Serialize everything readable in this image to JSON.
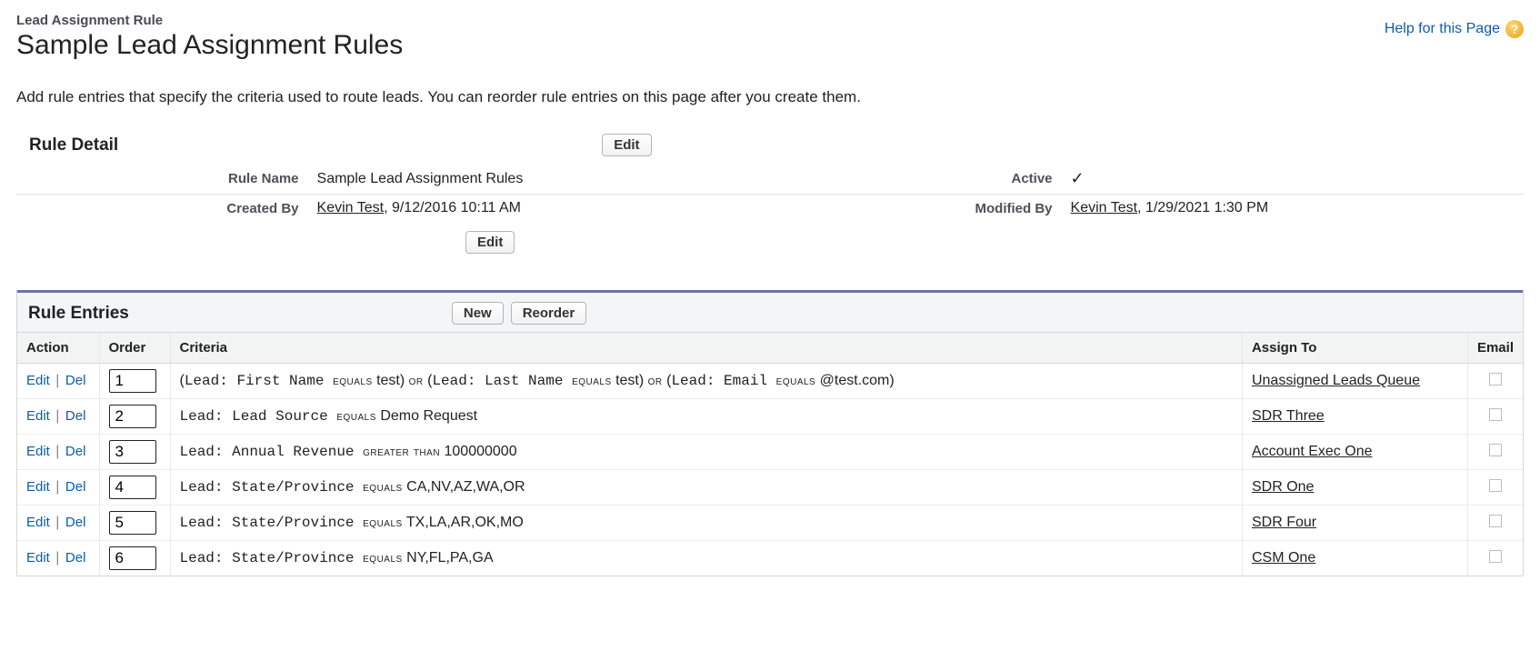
{
  "header": {
    "eyebrow": "Lead Assignment Rule",
    "title": "Sample Lead Assignment Rules",
    "help_label": "Help for this Page",
    "help_icon_char": "?"
  },
  "intro": "Add rule entries that specify the criteria used to route leads. You can reorder rule entries on this page after you create them.",
  "rule_detail": {
    "section_label": "Rule Detail",
    "edit_label": "Edit",
    "fields": {
      "rule_name_label": "Rule Name",
      "rule_name_value": "Sample Lead Assignment Rules",
      "active_label": "Active",
      "active_check": "✓",
      "created_by_label": "Created By",
      "created_by_user": "Kevin Test",
      "created_by_ts": ", 9/12/2016 10:11 AM",
      "modified_by_label": "Modified By",
      "modified_by_user": "Kevin Test",
      "modified_by_ts": ", 1/29/2021 1:30 PM"
    }
  },
  "rule_entries": {
    "section_label": "Rule Entries",
    "new_label": "New",
    "reorder_label": "Reorder",
    "columns": {
      "action": "Action",
      "order": "Order",
      "criteria": "Criteria",
      "assign_to": "Assign To",
      "email": "Email"
    },
    "action_edit": "Edit",
    "action_del": "Del",
    "action_sep": "|",
    "rows": [
      {
        "order": "1",
        "criteria_segments": [
          {
            "t": "(",
            "cls": ""
          },
          {
            "t": "Lead: First Name ",
            "cls": "mono"
          },
          {
            "t": "equals",
            "cls": "smallcaps"
          },
          {
            "t": " test",
            "cls": ""
          },
          {
            "t": ") ",
            "cls": ""
          },
          {
            "t": "or",
            "cls": "smallcaps"
          },
          {
            "t": " (",
            "cls": ""
          },
          {
            "t": "Lead: Last Name ",
            "cls": "mono"
          },
          {
            "t": "equals",
            "cls": "smallcaps"
          },
          {
            "t": " test",
            "cls": ""
          },
          {
            "t": ") ",
            "cls": ""
          },
          {
            "t": "or",
            "cls": "smallcaps"
          },
          {
            "t": " (",
            "cls": ""
          },
          {
            "t": "Lead: Email ",
            "cls": "mono"
          },
          {
            "t": "equals",
            "cls": "smallcaps"
          },
          {
            "t": " @test.com",
            "cls": ""
          },
          {
            "t": ")",
            "cls": ""
          }
        ],
        "assign_to": "Unassigned Leads Queue",
        "email": false
      },
      {
        "order": "2",
        "criteria_segments": [
          {
            "t": "Lead: Lead Source ",
            "cls": "mono"
          },
          {
            "t": "equals",
            "cls": "smallcaps"
          },
          {
            "t": " Demo Request",
            "cls": ""
          }
        ],
        "assign_to": "SDR Three",
        "email": false
      },
      {
        "order": "3",
        "criteria_segments": [
          {
            "t": "Lead: Annual Revenue ",
            "cls": "mono"
          },
          {
            "t": "greater than",
            "cls": "smallcaps"
          },
          {
            "t": " 100000000",
            "cls": ""
          }
        ],
        "assign_to": "Account Exec One",
        "email": false
      },
      {
        "order": "4",
        "criteria_segments": [
          {
            "t": "Lead: State/Province ",
            "cls": "mono"
          },
          {
            "t": "equals",
            "cls": "smallcaps"
          },
          {
            "t": " CA,NV,AZ,WA,OR",
            "cls": ""
          }
        ],
        "assign_to": "SDR One",
        "email": false
      },
      {
        "order": "5",
        "criteria_segments": [
          {
            "t": "Lead: State/Province ",
            "cls": "mono"
          },
          {
            "t": "equals",
            "cls": "smallcaps"
          },
          {
            "t": " TX,LA,AR,OK,MO",
            "cls": ""
          }
        ],
        "assign_to": "SDR Four",
        "email": false
      },
      {
        "order": "6",
        "criteria_segments": [
          {
            "t": "Lead: State/Province ",
            "cls": "mono"
          },
          {
            "t": "equals",
            "cls": "smallcaps"
          },
          {
            "t": " NY,FL,PA,GA",
            "cls": ""
          }
        ],
        "assign_to": "CSM One",
        "email": false
      }
    ]
  }
}
